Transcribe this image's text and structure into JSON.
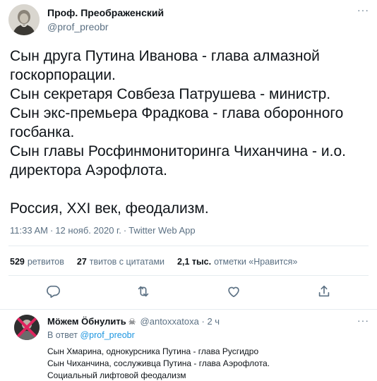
{
  "tweet": {
    "author_name": "Проф. Преображенский",
    "author_handle": "@prof_preobr",
    "more": "···",
    "lines": [
      "Сын друга Путина Иванова - глава алмазной",
      "госкорпорации.",
      "Сын секретаря Совбеза Патрушева - министр.",
      "Сын экс-премьера Фрадкова - глава оборонного",
      "госбанка.",
      "Сын главы Росфинмониторинга Чиханчина - и.о.",
      "директора Аэрофлота."
    ],
    "last_line": "Россия, XXI век, феодализм.",
    "time": "11:33 AM",
    "date": "12 нояб. 2020 г.",
    "source": "Twitter Web App",
    "dot": "·"
  },
  "stats": {
    "retweets_count": "529",
    "retweets_label": "ретвитов",
    "quotes_count": "27",
    "quotes_label": "твитов с цитатами",
    "likes_count": "2,1 тыс.",
    "likes_label": "отметки «Нравится»"
  },
  "actions": {
    "icons": [
      "reply-icon",
      "retweet-icon",
      "like-icon",
      "share-icon"
    ]
  },
  "reply": {
    "name": "Мöжем Ӧбнулить",
    "badge": "☠",
    "handle": "@antoxxatoxa",
    "dot": "·",
    "time": "2 ч",
    "more": "···",
    "reply_to_label": "В ответ",
    "reply_to_handle": "@prof_preobr",
    "lines": [
      "Сын Хмарина, однокурсника Путина - глава Русгидро",
      "Сын Чиханчина, сослуживца Путина - глава Аэрофлота.",
      "Социальный лифтовой феодализм"
    ]
  },
  "colors": {
    "text": "#0f1419",
    "secondary": "#5b7083",
    "link": "#1b95e0",
    "divider": "#e6ecf0"
  }
}
